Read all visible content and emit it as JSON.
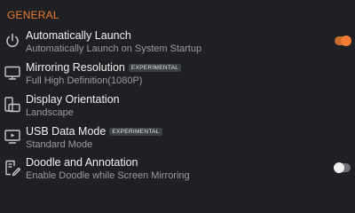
{
  "section": {
    "title": "GENERAL"
  },
  "colors": {
    "accent": "#f07a2e",
    "background": "#1e2024",
    "subtitle": "#9a9ca1"
  },
  "items": [
    {
      "title": "Automatically Launch",
      "subtitle": "Automatically Launch on System Startup",
      "icon": "power-icon",
      "control": "toggle",
      "toggle_on": true
    },
    {
      "title": "Mirroring Resolution",
      "badge": "EXPERIMENTAL",
      "subtitle": "Full High Definition(1080P)",
      "icon": "monitor-icon"
    },
    {
      "title": "Display Orientation",
      "subtitle": "Landscape",
      "icon": "rotate-screen-icon"
    },
    {
      "title": "USB Data Mode",
      "badge": "EXPERIMENTAL",
      "subtitle": "Standard Mode",
      "icon": "usb-screen-icon"
    },
    {
      "title": "Doodle and Annotation",
      "subtitle": "Enable Doodle while Screen Mirroring",
      "icon": "doodle-pen-icon",
      "control": "toggle",
      "toggle_on": false
    }
  ]
}
